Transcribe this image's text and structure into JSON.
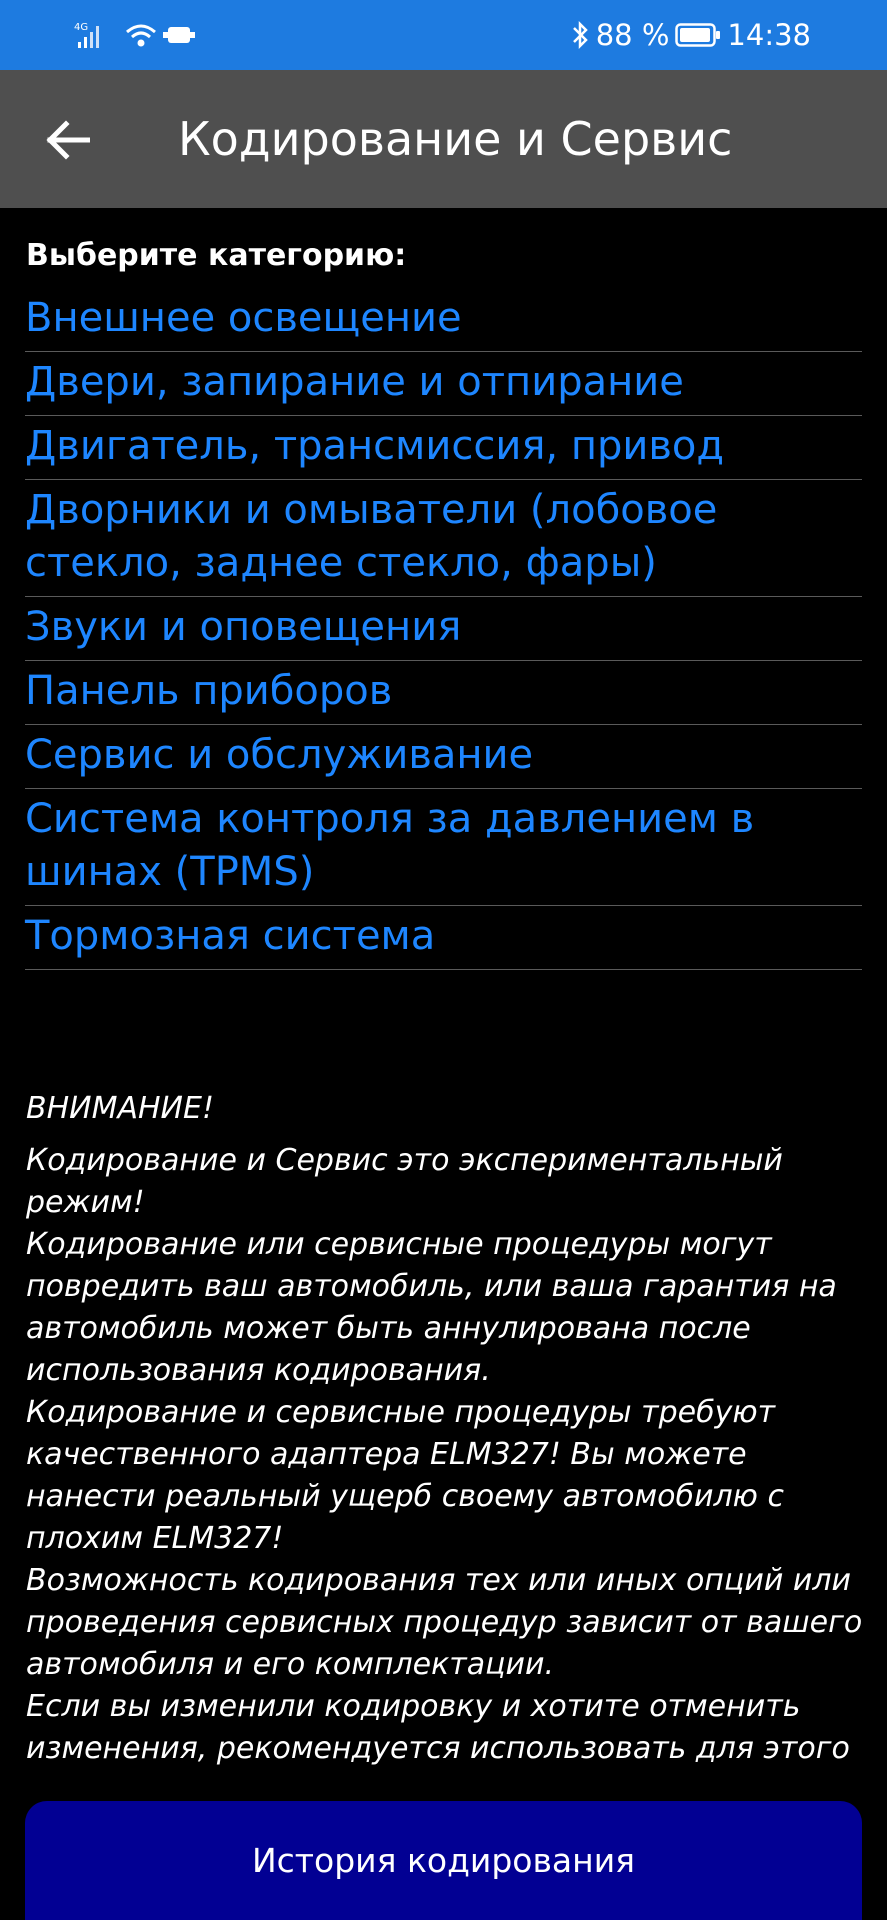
{
  "status_bar": {
    "network": "4G",
    "battery": "88 %",
    "time": "14:38",
    "icons": [
      "signal-icon",
      "wifi-icon",
      "obd-adapter-icon",
      "bluetooth-icon",
      "battery-icon"
    ]
  },
  "app_bar": {
    "title": "Кодирование и Сервис"
  },
  "content": {
    "prompt": "Выберите категорию:",
    "categories": [
      "Внешнее освещение",
      "Двери, запирание и отпирание",
      "Двигатель, трансмиссия, привод",
      "Дворники и омыватели (лобовое стекло, заднее стекло, фары)",
      "Звуки и оповещения",
      "Панель приборов",
      "Сервис и обслуживание",
      "Система контроля за давлением в шинах (TPMS)",
      "Тормозная система"
    ],
    "warning_title": "ВНИМАНИЕ!",
    "warning_body": "Кодирование и Сервис это экспериментальный режим!\nКодирование или сервисные процедуры могут повредить ваш автомобиль, или ваша гарантия на автомобиль может быть аннулирована после использования кодирования.\nКодирование и сервисные процедуры требуют качественного адаптера ELM327! Вы можете нанести реальный ущерб своему автомобилю с плохим ELM327!\nВозможность кодирования тех или иных опций или проведения сервисных процедур зависит от вашего автомобиля и его комплектации.\nЕсли вы изменили кодировку и хотите отменить изменения, рекомендуется использовать для этого"
  },
  "footer": {
    "history_button": "История кодирования"
  },
  "colors": {
    "status_bar": "#1e7be0",
    "app_bar": "#4f4f4f",
    "link": "#1e86ff",
    "button": "#020093"
  }
}
